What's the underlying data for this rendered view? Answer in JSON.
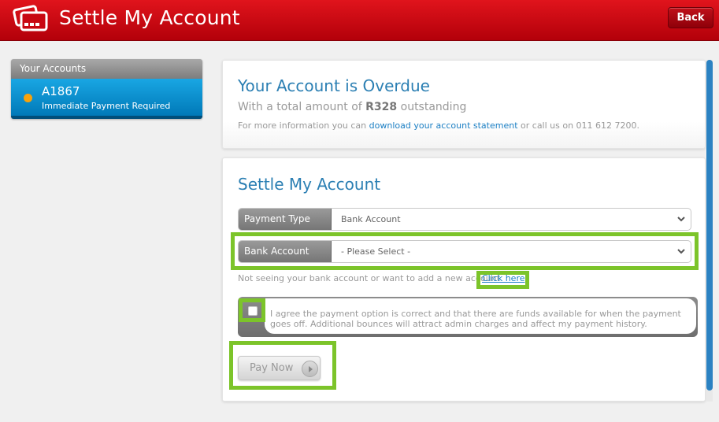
{
  "header": {
    "title": "Settle My Account",
    "back_label": "Back"
  },
  "sidebar": {
    "heading": "Your Accounts",
    "account": {
      "id": "A1867",
      "status": "Immediate Payment Required",
      "status_color": "#f7a20c"
    }
  },
  "overdue": {
    "title": "Your Account is Overdue",
    "sub_prefix": "With a total amount of",
    "amount": "R328",
    "sub_suffix": "outstanding",
    "info_prefix": "For more information you can",
    "statement_link": "download your account statement",
    "info_suffix": "or call us on 011 612 7200."
  },
  "settle": {
    "title": "Settle My Account",
    "payment_type_label": "Payment Type",
    "payment_type_value": "Bank Account",
    "bank_account_label": "Bank Account",
    "bank_account_value": "- Please Select -",
    "bank_hint": "Not seeing your bank account or want to add a new account",
    "click_here": "Click here",
    "agree_text": "I agree the payment option is correct and that there are funds available for when the payment goes off. Additional bounces will attract admin charges and affect my payment history.",
    "pay_label": "Pay Now"
  },
  "colors": {
    "brand_red": "#d40a14",
    "accent_blue": "#2b7fb3",
    "highlight_green": "#7cc42a"
  }
}
